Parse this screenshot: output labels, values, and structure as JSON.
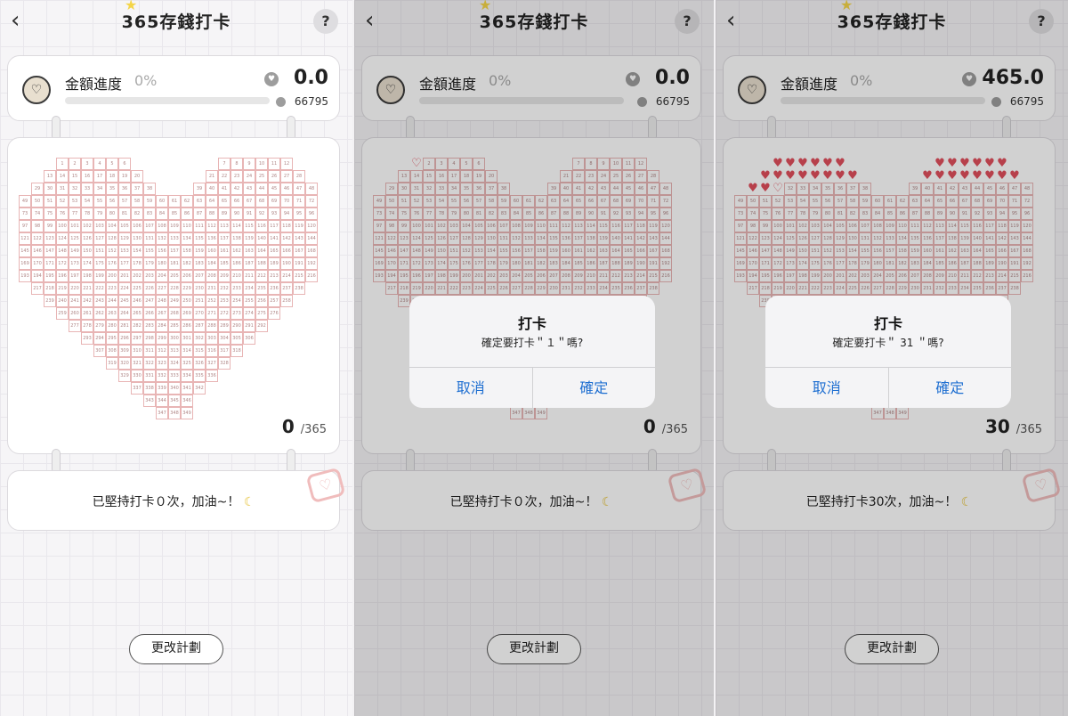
{
  "app": {
    "title": "365存錢打卡",
    "back_icon": "chevron-left-icon",
    "help_label": "?"
  },
  "total_days": 365,
  "panels": [
    {
      "progress": {
        "label": "金額進度",
        "percent_text": "0%",
        "fill_fraction": 0,
        "amount": "0.0",
        "goal": "66795"
      },
      "checked": [],
      "count": "0",
      "count_total": "/365",
      "note": "已堅持打卡０次，加油~！",
      "change_plan": "更改計劃",
      "dialog": null
    },
    {
      "progress": {
        "label": "金額進度",
        "percent_text": "0%",
        "fill_fraction": 0,
        "amount": "0.0",
        "goal": "66795"
      },
      "checked": [],
      "focus": 1,
      "count": "0",
      "count_total": "/365",
      "note": "已堅持打卡０次，加油~！",
      "change_plan": "更改計劃",
      "dialog": {
        "title": "打卡",
        "message": "確定要打卡＂１＂嗎?",
        "cancel": "取消",
        "confirm": "確定"
      }
    },
    {
      "progress": {
        "label": "金額進度",
        "percent_text": "0%",
        "fill_fraction": 0,
        "amount": "465.0",
        "goal": "66795"
      },
      "checked": [
        1,
        2,
        3,
        4,
        5,
        6,
        7,
        8,
        9,
        10,
        11,
        12,
        13,
        14,
        15,
        16,
        17,
        18,
        19,
        20,
        21,
        22,
        23,
        24,
        25,
        26,
        27,
        28,
        29,
        30
      ],
      "focus": 31,
      "count": "30",
      "count_total": "/365",
      "note": "已堅持打卡30次，加油~！",
      "change_plan": "更改計劃",
      "dialog": {
        "title": "打卡",
        "message": "確定要打卡＂ 31 ＂嗎?",
        "cancel": "取消",
        "confirm": "確定"
      }
    }
  ],
  "colors": {
    "accent_blue": "#1f6fd1",
    "heart_red": "#e04f5c",
    "cell_border": "#e8b5b5"
  }
}
